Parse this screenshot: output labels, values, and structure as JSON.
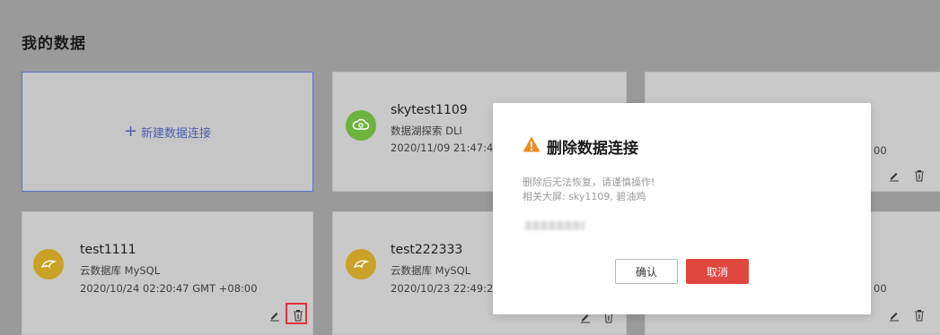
{
  "page": {
    "title": "我的数据"
  },
  "new_card": {
    "plus": "+",
    "label": "新建数据连接"
  },
  "cards": [
    {
      "title": "skytest1109",
      "type": "数据湖探索 DLI",
      "date": "2020/11/09 21:47:4",
      "icon": "cloud-lake-icon",
      "icon_color": "#6db33f"
    },
    {
      "title": "test1111",
      "type": "云数据库 MySQL",
      "date": "2020/10/24 02:20:47 GMT +08:00",
      "icon": "dolphin-icon",
      "icon_color": "#c9a227"
    },
    {
      "title": "test222333",
      "type": "云数据库 MySQL",
      "date": "2020/10/23 22:49:2",
      "icon": "dolphin-icon",
      "icon_color": "#c9a227"
    },
    {
      "date_tail": "00"
    },
    {
      "date_tail": "00"
    }
  ],
  "modal": {
    "title": "删除数据连接",
    "warning": "删除后无法恢复，请谨慎操作!",
    "related": "相关大屏: sky1109, 碧油鸡",
    "confirm_label": "确认",
    "cancel_label": "取消",
    "warning_color": "#f08a24",
    "cancel_color": "#e0473e"
  }
}
